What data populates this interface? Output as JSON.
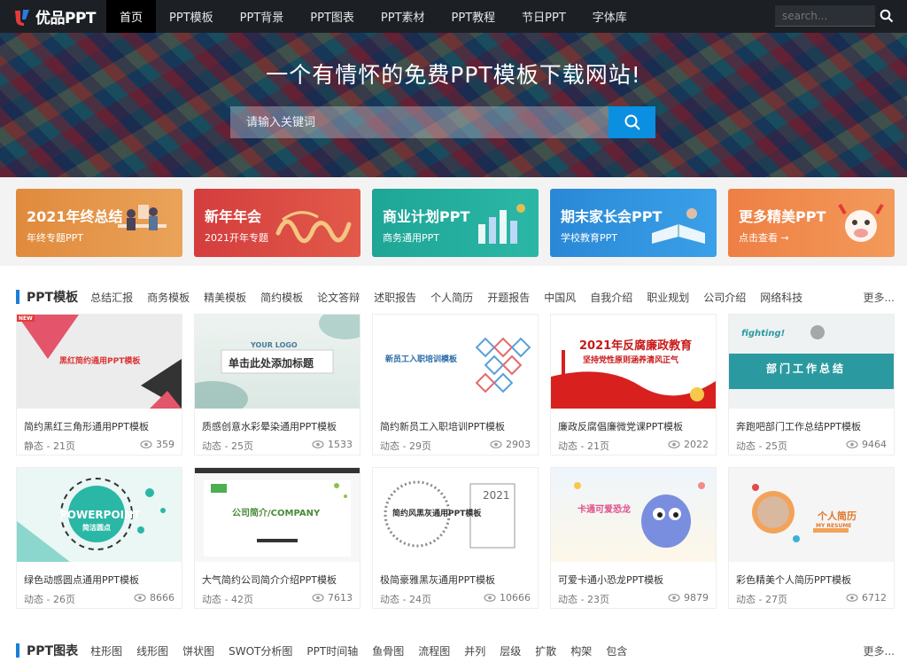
{
  "nav": {
    "logo_text": "优品PPT",
    "items": [
      "首页",
      "PPT模板",
      "PPT背景",
      "PPT图表",
      "PPT素材",
      "PPT教程",
      "节日PPT",
      "字体库"
    ],
    "search_placeholder": "search..."
  },
  "hero": {
    "title": "一个有情怀的免费PPT模板下载网站!",
    "search_placeholder": "请输入关键词"
  },
  "banners": [
    {
      "title": "2021年终总结",
      "subtitle": "年终专题PPT",
      "color": "#e08a3c"
    },
    {
      "title": "新年年会",
      "subtitle": "2021开年专题",
      "color": "#d94a4a"
    },
    {
      "title": "商业计划PPT",
      "subtitle": "商务通用PPT",
      "color": "#21a99b"
    },
    {
      "title": "期末家长会PPT",
      "subtitle": "学校教育PPT",
      "color": "#2b8ed8"
    },
    {
      "title": "更多精美PPT",
      "subtitle": "点击查看 →",
      "color": "#f0884a"
    }
  ],
  "section1": {
    "title": "PPT模板",
    "tags": [
      "总结汇报",
      "商务模板",
      "精美模板",
      "简约模板",
      "论文答辩",
      "述职报告",
      "个人简历",
      "开题报告",
      "中国风",
      "自我介绍",
      "职业规划",
      "公司介绍",
      "网络科技"
    ],
    "more": "更多..."
  },
  "cards": [
    {
      "title": "简约黑红三角形通用PPT模板",
      "meta": "静态 - 21页",
      "views": "359",
      "thumb_text": "黑红简约通用PPT模板",
      "thumb_bg": "#ececec",
      "badge": "NEW"
    },
    {
      "title": "质感创意水彩晕染通用PPT模板",
      "meta": "动态 - 25页",
      "views": "1533",
      "thumb_text": "单击此处添加标题",
      "thumb_sub": "YOUR LOGO",
      "thumb_bg": "#eef3f0"
    },
    {
      "title": "简约新员工入职培训PPT模板",
      "meta": "动态 - 29页",
      "views": "2903",
      "thumb_text": "新员工入职培训模板",
      "thumb_bg": "#ffffff"
    },
    {
      "title": "廉政反腐倡廉微党课PPT模板",
      "meta": "动态 - 21页",
      "views": "2022",
      "thumb_text": "2021年反腐廉政教育",
      "thumb_sub": "坚持党性原则涵养清风正气",
      "thumb_bg": "#ffffff"
    },
    {
      "title": "奔跑吧部门工作总结PPT模板",
      "meta": "动态 - 25页",
      "views": "9464",
      "thumb_text": "部门工作总结",
      "thumb_sub": "fighting!",
      "thumb_bg": "#e9eff0"
    },
    {
      "title": "绿色动感圆点通用PPT模板",
      "meta": "动态 - 26页",
      "views": "8666",
      "thumb_text": "POWERPOINT",
      "thumb_sub": "简洁圆点",
      "thumb_bg": "#eaf7f5"
    },
    {
      "title": "大气简约公司简介介绍PPT模板",
      "meta": "动态 - 42页",
      "views": "7613",
      "thumb_text": "公司简介/COMPANY",
      "thumb_bg": "#f7f7f7"
    },
    {
      "title": "极简豪雅黑灰通用PPT模板",
      "meta": "动态 - 24页",
      "views": "10666",
      "thumb_text": "简约风黑灰通用PPT模板",
      "thumb_sub": "2021",
      "thumb_bg": "#ffffff"
    },
    {
      "title": "可爱卡通小恐龙PPT模板",
      "meta": "动态 - 23页",
      "views": "9879",
      "thumb_text": "卡通可爱恐龙",
      "thumb_bg": "#eef5fb"
    },
    {
      "title": "彩色精美个人简历PPT模板",
      "meta": "动态 - 27页",
      "views": "6712",
      "thumb_text": "个人简历",
      "thumb_sub": "MY RESUME",
      "thumb_bg": "#f5f5f5"
    }
  ],
  "section2": {
    "title": "PPT图表",
    "tags": [
      "柱形图",
      "线形图",
      "饼状图",
      "SWOT分析图",
      "PPT时间轴",
      "鱼骨图",
      "流程图",
      "并列",
      "层级",
      "扩散",
      "构架",
      "包含"
    ],
    "more": "更多..."
  }
}
